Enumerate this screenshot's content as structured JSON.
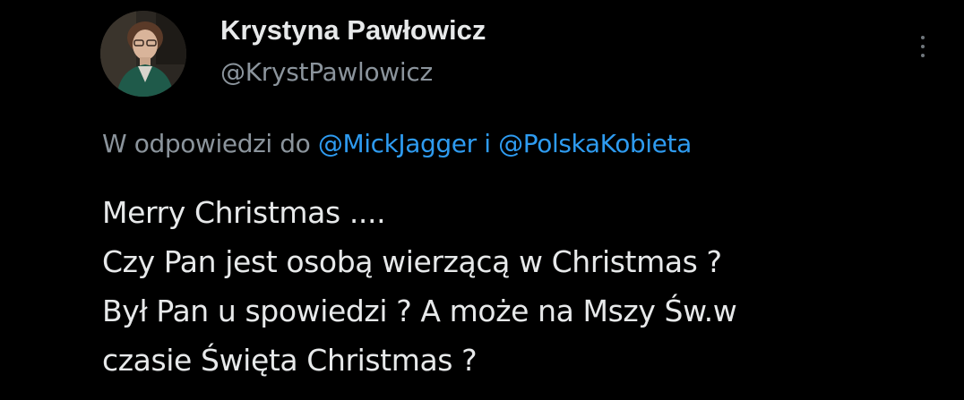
{
  "author": {
    "display_name": "Krystyna Pawłowicz",
    "handle": "@KrystPawlowicz",
    "avatar_icon": "user-avatar-photo"
  },
  "reply": {
    "prefix": "W odpowiedzi do",
    "mention_1": "@MickJagger",
    "conjunction": "i",
    "mention_2": "@PolskaKobieta"
  },
  "tweet_text": [
    "Merry Christmas ....",
    "Czy Pan jest osobą wierzącą w Christmas ?",
    "Był Pan u spowiedzi ? A może na Mszy Św.w",
    "czasie Święta Christmas ?"
  ],
  "icons": {
    "more": "more-vertical-icon"
  },
  "colors": {
    "background": "#000000",
    "text": "#e7e9ea",
    "secondary": "#8b949c",
    "link": "#2e9bf0"
  }
}
